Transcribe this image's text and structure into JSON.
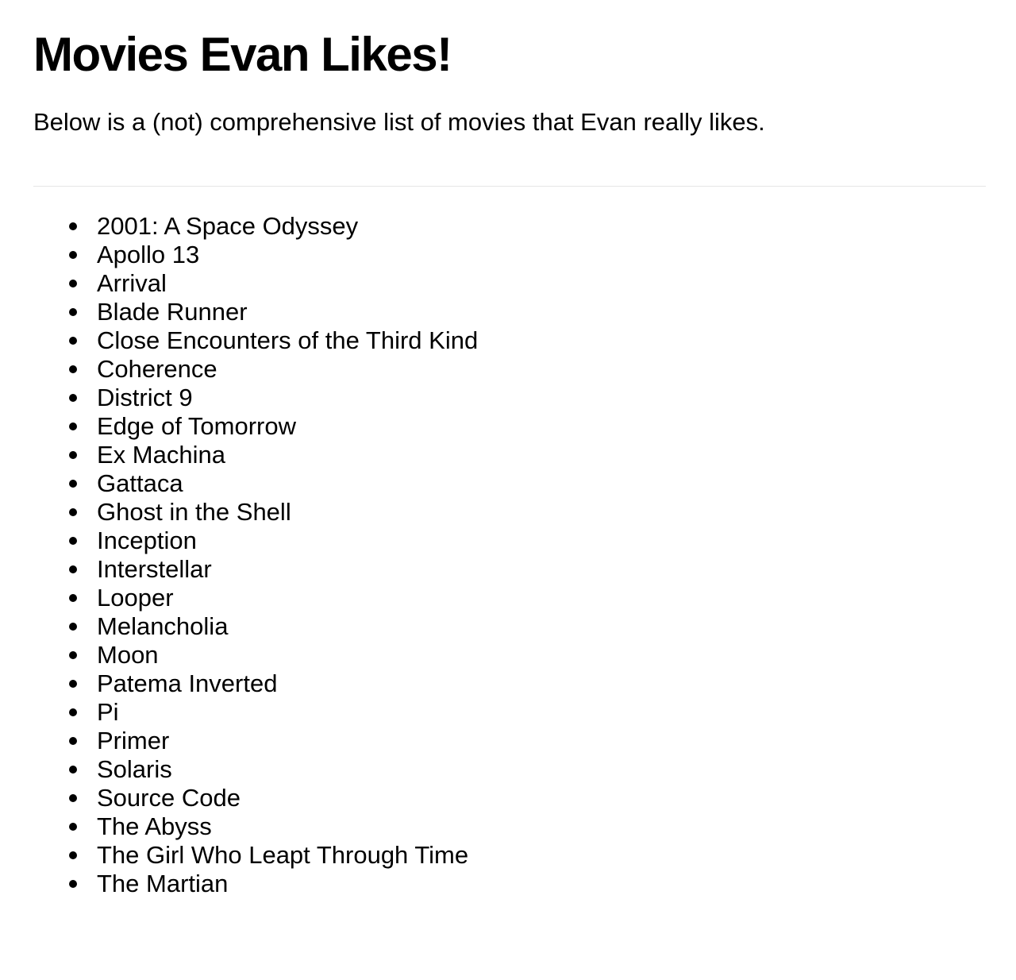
{
  "header": {
    "title": "Movies Evan Likes!"
  },
  "intro": {
    "text": "Below is a (not) comprehensive list of movies that Evan really likes."
  },
  "movies": [
    "2001: A Space Odyssey",
    "Apollo 13",
    "Arrival",
    "Blade Runner",
    "Close Encounters of the Third Kind",
    "Coherence",
    "District 9",
    "Edge of Tomorrow",
    "Ex Machina",
    "Gattaca",
    "Ghost in the Shell",
    "Inception",
    "Interstellar",
    "Looper",
    "Melancholia",
    "Moon",
    "Patema Inverted",
    "Pi",
    "Primer",
    "Solaris",
    "Source Code",
    "The Abyss",
    "The Girl Who Leapt Through Time",
    "The Martian"
  ]
}
